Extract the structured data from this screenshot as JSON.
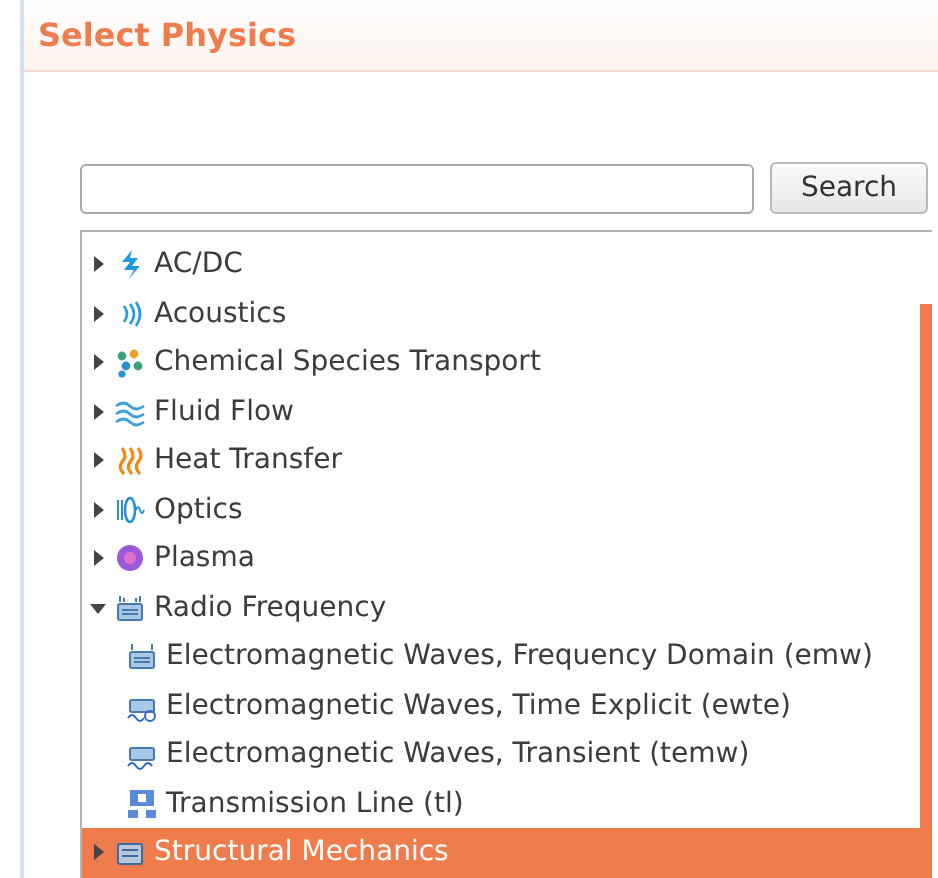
{
  "header": {
    "title": "Select Physics"
  },
  "search": {
    "button": "Search"
  },
  "tree": [
    {
      "label": "AC/DC",
      "expanded": false,
      "selected": false
    },
    {
      "label": "Acoustics",
      "expanded": false,
      "selected": false
    },
    {
      "label": "Chemical Species Transport",
      "expanded": false,
      "selected": false
    },
    {
      "label": "Fluid Flow",
      "expanded": false,
      "selected": false
    },
    {
      "label": "Heat Transfer",
      "expanded": false,
      "selected": false
    },
    {
      "label": "Optics",
      "expanded": false,
      "selected": false
    },
    {
      "label": "Plasma",
      "expanded": false,
      "selected": false
    },
    {
      "label": "Radio Frequency",
      "expanded": true,
      "selected": false,
      "children": [
        {
          "label": "Electromagnetic Waves, Frequency Domain (emw)",
          "selected": false
        },
        {
          "label": "Electromagnetic Waves, Time Explicit (ewte)",
          "selected": false
        },
        {
          "label": "Electromagnetic Waves, Transient (temw)",
          "selected": false
        },
        {
          "label": "Transmission Line (tl)",
          "selected": false
        }
      ]
    },
    {
      "label": "Structural Mechanics",
      "expanded": false,
      "selected": true
    }
  ]
}
